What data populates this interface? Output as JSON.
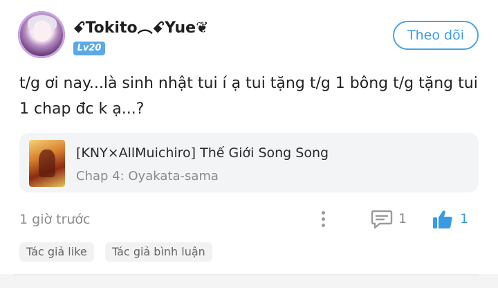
{
  "post": {
    "author": {
      "username": "ꗃTokito︵ꗃYue❦",
      "level": "Lv20"
    },
    "follow_label": "Theo dõi",
    "content": "t/g ơi nay...là sinh nhật tui í ạ tui tặng t/g 1 bông t/g tặng tui 1 chap đc k ạ...?",
    "story": {
      "title": "[KNY×AllMuichiro] Thế Giới Song Song",
      "chapter": "Chap 4: Oyakata-sama"
    },
    "timestamp": "1 giờ trước",
    "comment_count": "1",
    "like_count": "1",
    "tags": [
      "Tác giả like",
      "Tác giả bình luận"
    ],
    "colors": {
      "accent": "#3a9ae4",
      "level_badge": "#5aa9e6",
      "card_bg": "#f3f4f6"
    },
    "icons": {
      "more": "more-vertical-icon",
      "comment": "comment-icon",
      "like": "thumbs-up-icon"
    }
  }
}
